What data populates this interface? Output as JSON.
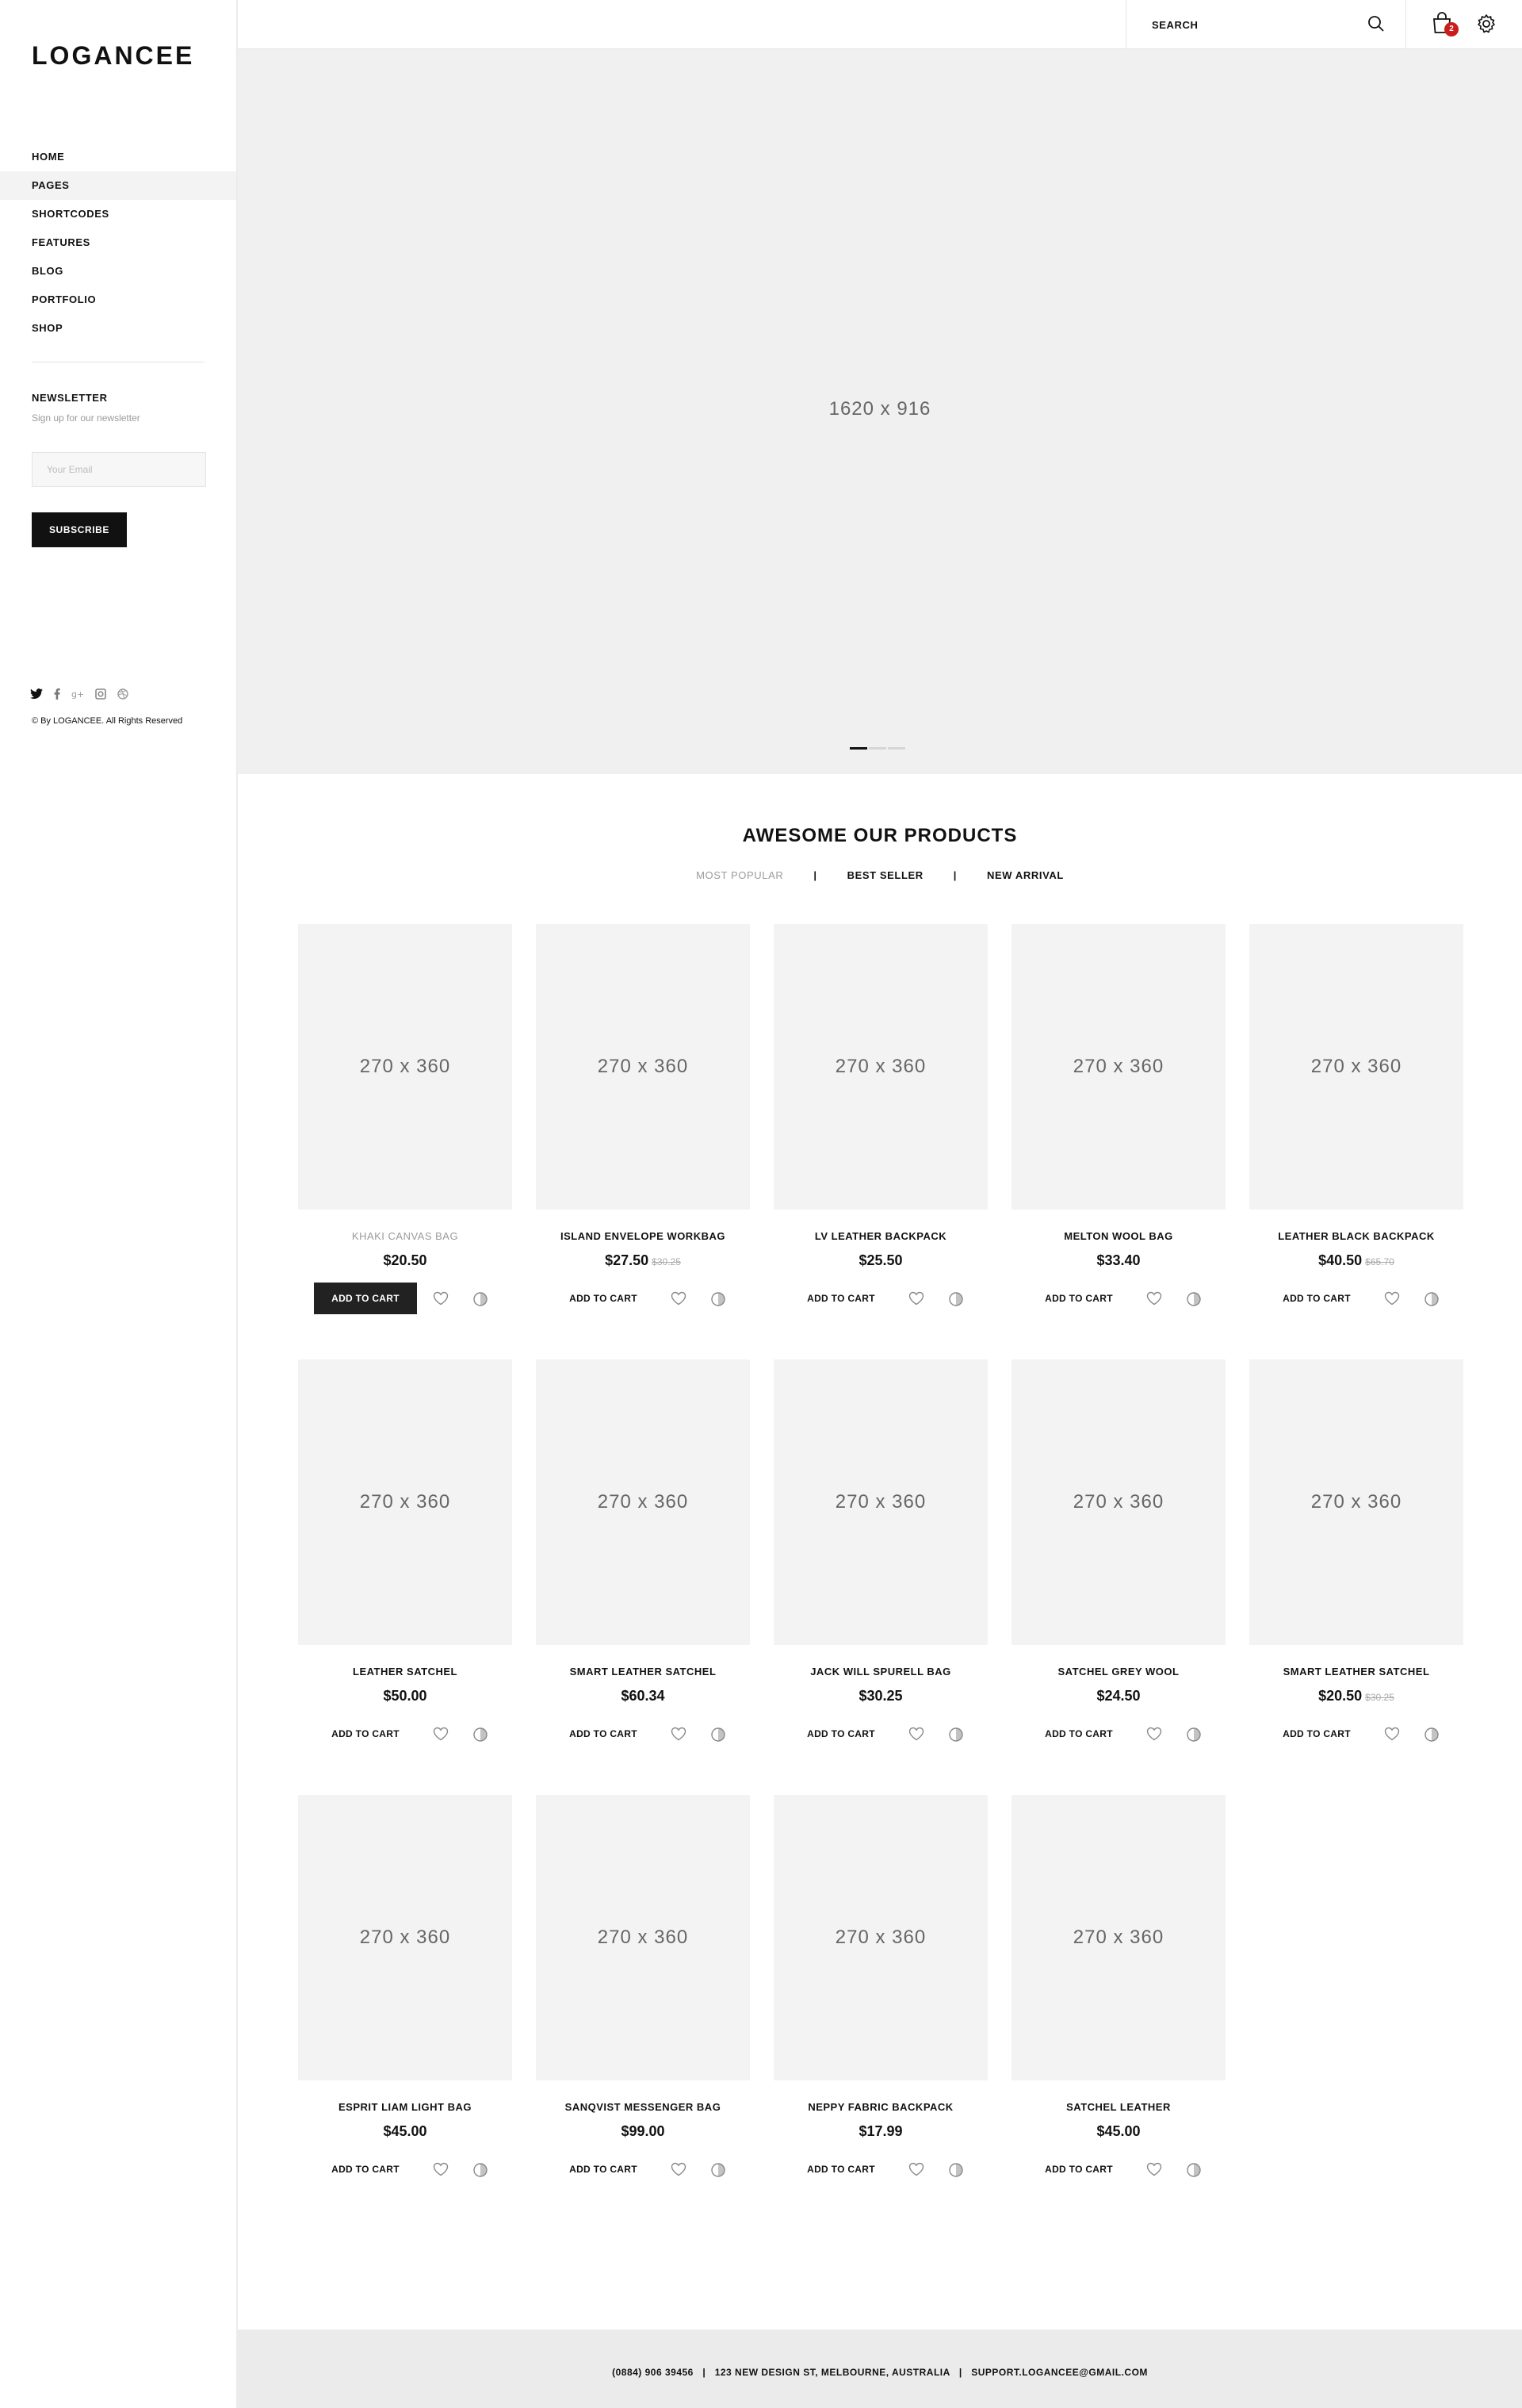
{
  "brand": "LOGANCEE",
  "nav": [
    "HOME",
    "PAGES",
    "SHORTCODES",
    "FEATURES",
    "BLOG",
    "PORTFOLIO",
    "SHOP"
  ],
  "newsletter": {
    "title": "NEWSLETTER",
    "subtitle": "Sign up for our newsletter",
    "placeholder": "Your Email",
    "button": "SUBSCRIBE"
  },
  "copyright": "© By LOGANCEE. All Rights Reserved",
  "search": {
    "placeholder": "SEARCH"
  },
  "cart": {
    "count": "2"
  },
  "hero": {
    "label": "1620 x 916"
  },
  "products_section": {
    "title": "AWESOME OUR PRODUCTS",
    "tabs": [
      "MOST POPULAR",
      "BEST SELLER",
      "NEW ARRIVAL"
    ],
    "active_tab": "MOST POPULAR"
  },
  "products": [
    {
      "image": "270 x 360",
      "name": "KHAKI CANVAS BAG",
      "price": "$20.50",
      "old_price": "",
      "cart": "ADD TO CART"
    },
    {
      "image": "270 x 360",
      "name": "ISLAND ENVELOPE WORKBAG",
      "price": "$27.50",
      "old_price": "$30.25",
      "cart": "ADD TO CART"
    },
    {
      "image": "270 x 360",
      "name": "LV LEATHER BACKPACK",
      "price": "$25.50",
      "old_price": "",
      "cart": "ADD TO CART"
    },
    {
      "image": "270 x 360",
      "name": "MELTON WOOL BAG",
      "price": "$33.40",
      "old_price": "",
      "cart": "ADD TO CART"
    },
    {
      "image": "270 x 360",
      "name": "LEATHER BLACK BACKPACK",
      "price": "$40.50",
      "old_price": "$65.70",
      "cart": "ADD TO CART"
    },
    {
      "image": "270 x 360",
      "name": "LEATHER SATCHEL",
      "price": "$50.00",
      "old_price": "",
      "cart": "ADD TO CART"
    },
    {
      "image": "270 x 360",
      "name": "SMART LEATHER SATCHEL",
      "price": "$60.34",
      "old_price": "",
      "cart": "ADD TO CART"
    },
    {
      "image": "270 x 360",
      "name": "JACK WILL SPURELL BAG",
      "price": "$30.25",
      "old_price": "",
      "cart": "ADD TO CART"
    },
    {
      "image": "270 x 360",
      "name": "SATCHEL GREY WOOL",
      "price": "$24.50",
      "old_price": "",
      "cart": "ADD TO CART"
    },
    {
      "image": "270 x 360",
      "name": "SMART LEATHER SATCHEL",
      "price": "$20.50",
      "old_price": "$30.25",
      "cart": "ADD TO CART"
    },
    {
      "image": "270 x 360",
      "name": "ESPRIT LIAM LIGHT BAG",
      "price": "$45.00",
      "old_price": "",
      "cart": "ADD TO CART"
    },
    {
      "image": "270 x 360",
      "name": "SANQVIST MESSENGER BAG",
      "price": "$99.00",
      "old_price": "",
      "cart": "ADD TO CART"
    },
    {
      "image": "270 x 360",
      "name": "NEPPY FABRIC BACKPACK",
      "price": "$17.99",
      "old_price": "",
      "cart": "ADD TO CART"
    },
    {
      "image": "270 x 360",
      "name": "SATCHEL LEATHER",
      "price": "$45.00",
      "old_price": "",
      "cart": "ADD TO CART"
    }
  ],
  "footer": {
    "text": "(0884) 906 39456   |   123 NEW DESIGN ST, MELBOURNE, AUSTRALIA   |   SUPPORT.LOGANCEE@GMAIL.COM"
  },
  "colors": {
    "badge": "#c91c1c",
    "dark_button": "#222222",
    "placeholder_bg": "#f3f3f3"
  },
  "icons": [
    "search-icon",
    "cart-icon",
    "gear-icon",
    "heart-icon",
    "compare-icon",
    "twitter-icon",
    "facebook-icon",
    "google-plus-icon",
    "instagram-icon",
    "dribbble-icon"
  ]
}
